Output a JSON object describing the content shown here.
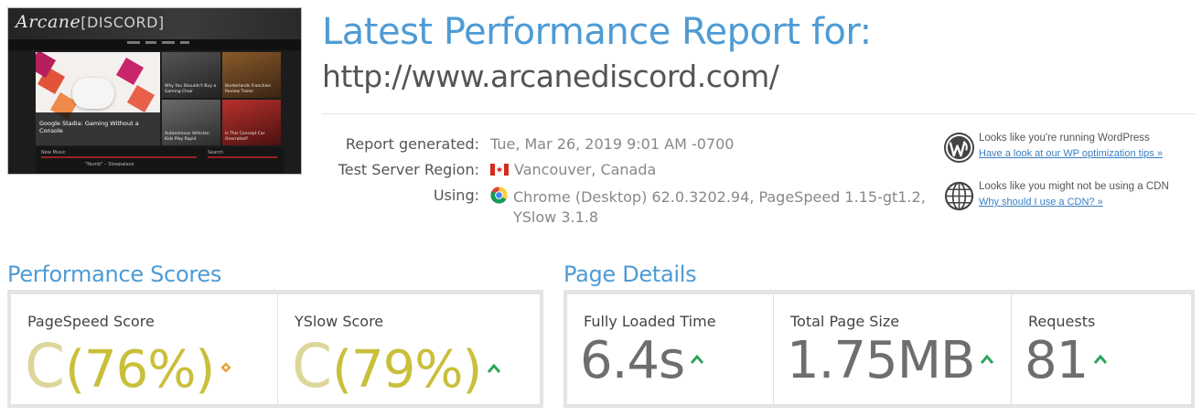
{
  "thumbnail": {
    "site_logo": "Arcane",
    "site_logo_bracket": "[DISCORD]",
    "hero_caption": "Google Stadia: Gaming Without a Console",
    "tiles": [
      "Why You Shouldn't Buy a Gaming Chair",
      "Borderlands Franchise Review Trailer",
      "Autonomous Vehicles: Kids Play Rapid",
      "Is This Concept Car Overrated?"
    ],
    "bottom_left": "New Music",
    "bottom_right": "Search",
    "bottom_item": "\"Numb\" – Slowpalace"
  },
  "header": {
    "title": "Latest Performance Report for:",
    "url": "http://www.arcanediscord.com/"
  },
  "report": {
    "generated_label": "Report generated:",
    "generated_value": "Tue, Mar 26, 2019 9:01 AM -0700",
    "region_label": "Test Server Region:",
    "region_value": "Vancouver, Canada",
    "using_label": "Using:",
    "using_value_line1": "Chrome (Desktop) 62.0.3202.94, PageSpeed 1.15-gt1.2,",
    "using_value_line2": "YSlow 3.1.8",
    "icons": {
      "region": "canada-flag-icon",
      "browser": "chrome-icon"
    }
  },
  "notices": [
    {
      "icon": "wordpress-icon",
      "text": "Looks like you're running WordPress",
      "link": "Have a look at our WP optimization tips »"
    },
    {
      "icon": "globe-icon",
      "text": "Looks like you might not be using a CDN",
      "link": "Why should I use a CDN? »"
    }
  ],
  "performance_scores": {
    "title": "Performance Scores",
    "pagespeed": {
      "label": "PageSpeed Score",
      "grade": "C",
      "percent": "(76%)",
      "trend_icon": "diamond-icon"
    },
    "yslow": {
      "label": "YSlow Score",
      "grade": "C",
      "percent": "(79%)",
      "trend_icon": "up-arrow-icon"
    }
  },
  "page_details": {
    "title": "Page Details",
    "fully_loaded": {
      "label": "Fully Loaded Time",
      "value": "6.4s",
      "trend_icon": "up-arrow-icon"
    },
    "page_size": {
      "label": "Total Page Size",
      "value": "1.75MB",
      "trend_icon": "up-arrow-icon"
    },
    "requests": {
      "label": "Requests",
      "value": "81",
      "trend_icon": "up-arrow-icon"
    }
  },
  "colors": {
    "accent": "#4e9bd5",
    "grade": "#c9bf3a",
    "trend_up": "#2ea55a",
    "trend_neutral": "#e8a23a",
    "link": "#3a7fc4"
  }
}
